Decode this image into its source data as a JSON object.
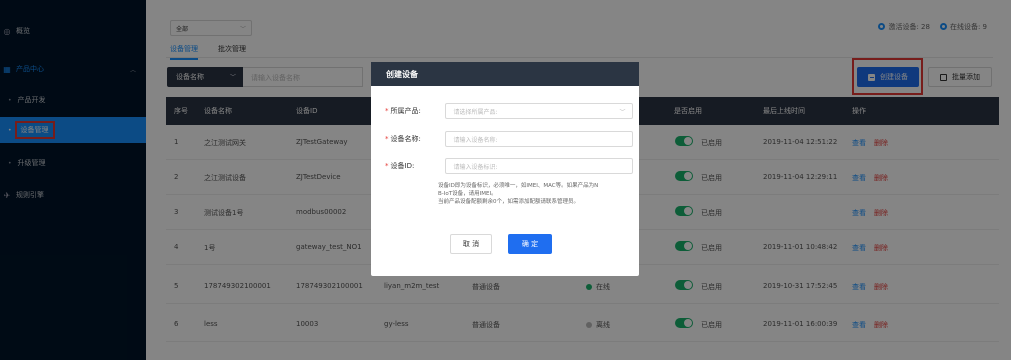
{
  "sidebar": {
    "overview": "概览",
    "product_center": "产品中心",
    "product_dev": "产品开发",
    "device_mgmt": "设备管理",
    "upgrade_mgmt": "升级管理",
    "rule_engine": "规则引擎"
  },
  "filter": {
    "selected": "全部"
  },
  "tabs": [
    "设备管理",
    "批次管理"
  ],
  "status": {
    "active_label": "激活设备: 28",
    "online_label": "在线设备: 9"
  },
  "search": {
    "type": "设备名称",
    "placeholder": "请输入设备名称"
  },
  "actions": {
    "create": "创建设备",
    "batch_add": "批量添加"
  },
  "table": {
    "headers": [
      "序号",
      "设备名称",
      "设备ID",
      "是否启用",
      "最后上线时间",
      "操作"
    ],
    "rows": [
      {
        "no": "1",
        "name": "之江测试网关",
        "id": "ZJTestGateway",
        "enabled": "已启用",
        "time": "2019-11-04 12:51:22"
      },
      {
        "no": "2",
        "name": "之江测试设备",
        "id": "ZJTestDevice",
        "enabled": "已启用",
        "time": "2019-11-04 12:29:11"
      },
      {
        "no": "3",
        "name": "测试设备1号",
        "id": "modbus00002",
        "enabled": "已启用",
        "time": ""
      },
      {
        "no": "4",
        "name": "1号",
        "id": "gateway_test_NO1",
        "enabled": "已启用",
        "time": "2019-11-01 10:48:42"
      },
      {
        "no": "5",
        "name": "178749302100001",
        "id": "178749302100001",
        "product": "liyan_m2m_test",
        "type": "普通设备",
        "state": "在线",
        "enabled": "已启用",
        "time": "2019-10-31 17:52:45"
      },
      {
        "no": "6",
        "name": "less",
        "id": "10003",
        "product": "gy-less",
        "type": "普通设备",
        "state": "离线",
        "enabled": "已启用",
        "time": "2019-11-01 16:00:39"
      }
    ],
    "view": "查看",
    "delete": "删除",
    "online_color": "#1ab26b",
    "offline_color": "#bbbbbb"
  },
  "modal": {
    "title": "创建设备",
    "product_label": "所属产品:",
    "product_placeholder": "请选择所属产品:",
    "name_label": "设备名称:",
    "name_placeholder": "请输入设备名称:",
    "id_label": "设备ID:",
    "id_placeholder": "请输入设备标识:",
    "hint_line1": "设备ID即为设备标识，必须唯一，如IMEI、MAC等。如果产品为N",
    "hint_line2": "B-IoT设备，请用IMEI。",
    "hint_line3": "当前产品设备配额剩余0个，如需添加配额请联系管理员。",
    "cancel": "取 消",
    "ok": "确 定"
  }
}
